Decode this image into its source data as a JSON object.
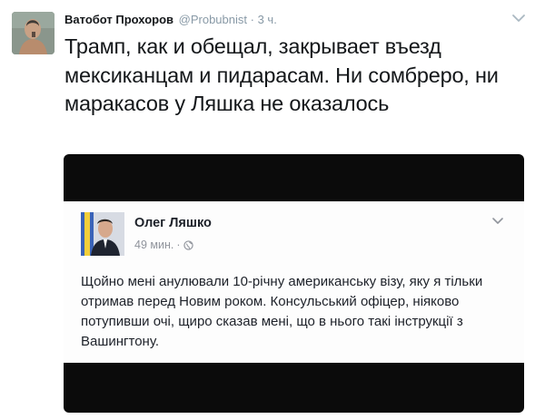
{
  "tweet": {
    "author_name": "Ватобот Прохоров",
    "author_handle": "@Probubnist",
    "separator": "·",
    "timestamp": "3 ч.",
    "avatar_icon": "user-avatar-photo",
    "menu_icon": "chevron-down-icon",
    "text": "Трамп, как и обещал, закрывает въезд мексиканцам и пидарасам. Ни сомбреро, ни маракасов у Ляшка не оказалось"
  },
  "embedded_post": {
    "author_name": "Олег Ляшко",
    "time": "49 мин.",
    "separator": "·",
    "privacy_icon": "globe-icon",
    "menu_icon": "chevron-down-icon",
    "text": "Щойно мені анулювали 10-річну американську візу, яку я тільки отримав перед Новим роком. Консульський офіцер, ніяково потупивши очі, щиро сказав мені, що в нього такі інструкції з Вашингтону."
  },
  "colors": {
    "text_primary": "#14171a",
    "text_secondary": "#8899a6",
    "media_background": "#0b0b0b",
    "fb_text": "#1d2129",
    "fb_meta": "#90949c"
  }
}
